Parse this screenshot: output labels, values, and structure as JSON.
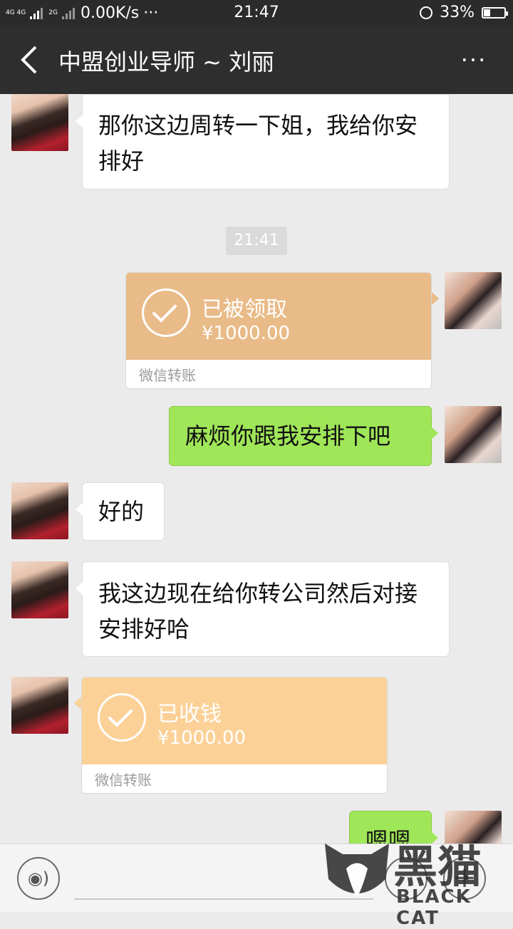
{
  "status_bar": {
    "network_1": "4G 4G",
    "network_2": "2G",
    "speed": "0.00K/s",
    "dots": "···",
    "time": "21:47",
    "battery_percent": "33%",
    "battery_level": 0.33
  },
  "header": {
    "title": "中盟创业导师 ~ 刘丽",
    "more": "···"
  },
  "messages": [
    {
      "from": "peer",
      "type": "text",
      "text": "那你这边周转一下姐，我给你安排好"
    },
    {
      "type": "timestamp",
      "text": "21:41"
    },
    {
      "from": "self",
      "type": "transfer",
      "status": "已被领取",
      "amount": "¥1000.00",
      "footer": "微信转账"
    },
    {
      "from": "self",
      "type": "text",
      "text": "麻烦你跟我安排下吧"
    },
    {
      "from": "peer",
      "type": "text",
      "text": "好的"
    },
    {
      "from": "peer",
      "type": "text",
      "text": "我这边现在给你转公司然后对接安排好哈"
    },
    {
      "from": "peer",
      "type": "transfer",
      "status": "已收钱",
      "amount": "¥1000.00",
      "footer": "微信转账"
    },
    {
      "from": "self",
      "type": "text",
      "text": "嗯嗯"
    }
  ],
  "watermark": {
    "cn": "黑猫",
    "en": "BLACK CAT"
  },
  "colors": {
    "transfer_received": "#e9bb88",
    "transfer_collected": "#fcd197",
    "self_bubble": "#9fe658",
    "header_bg": "#2e2e2e"
  }
}
